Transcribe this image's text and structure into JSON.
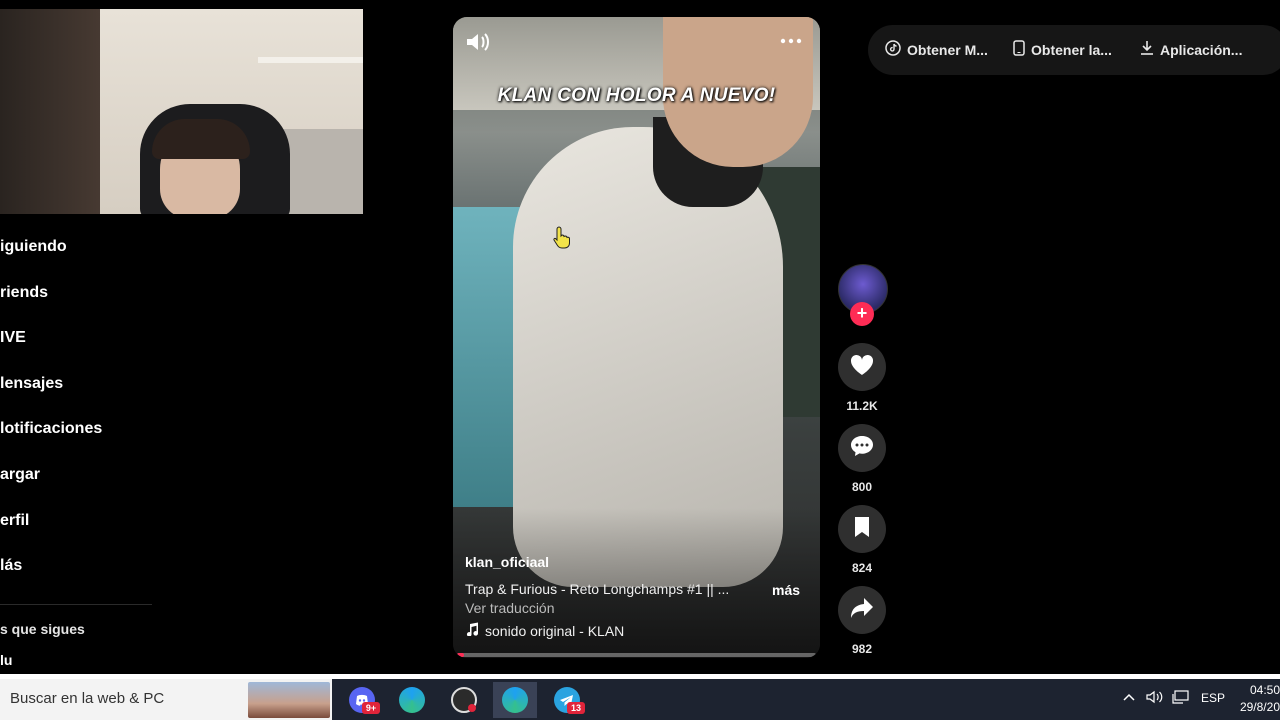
{
  "nav": {
    "items": [
      {
        "label": "iguiendo"
      },
      {
        "label": "riends"
      },
      {
        "label": "IVE"
      },
      {
        "label": "lensajes"
      },
      {
        "label": "lotificaciones"
      },
      {
        "label": "argar"
      },
      {
        "label": "erfil"
      },
      {
        "label": "lás"
      }
    ],
    "following_title": "s que sigues",
    "following_item": "lu"
  },
  "video": {
    "caption": "KLAN CON HOLOR A NUEVO!",
    "author": "klan_oficiaal",
    "description": "Trap & Furious - Reto Longchamps #1  || ...",
    "more_label": "más",
    "translate_label": "Ver traducción",
    "sound": "sonido original - KLAN",
    "progress": 0.02
  },
  "actions": {
    "likes": "11.2K",
    "comments": "800",
    "saves": "824",
    "shares": "982"
  },
  "top_pills": [
    {
      "label": "Obtener M...",
      "icon": "tiktok-icon"
    },
    {
      "label": "Obtener la...",
      "icon": "phone-icon"
    },
    {
      "label": "Aplicación...",
      "icon": "download-icon"
    }
  ],
  "taskbar": {
    "search_placeholder": "Buscar en la web & PC",
    "discord_badge": "9+",
    "telegram_badge": "13",
    "language": "ESP",
    "time": "04:50",
    "date": "29/8/20"
  },
  "colors": {
    "accent": "#fe2c55",
    "taskbar": "#1d2330"
  }
}
